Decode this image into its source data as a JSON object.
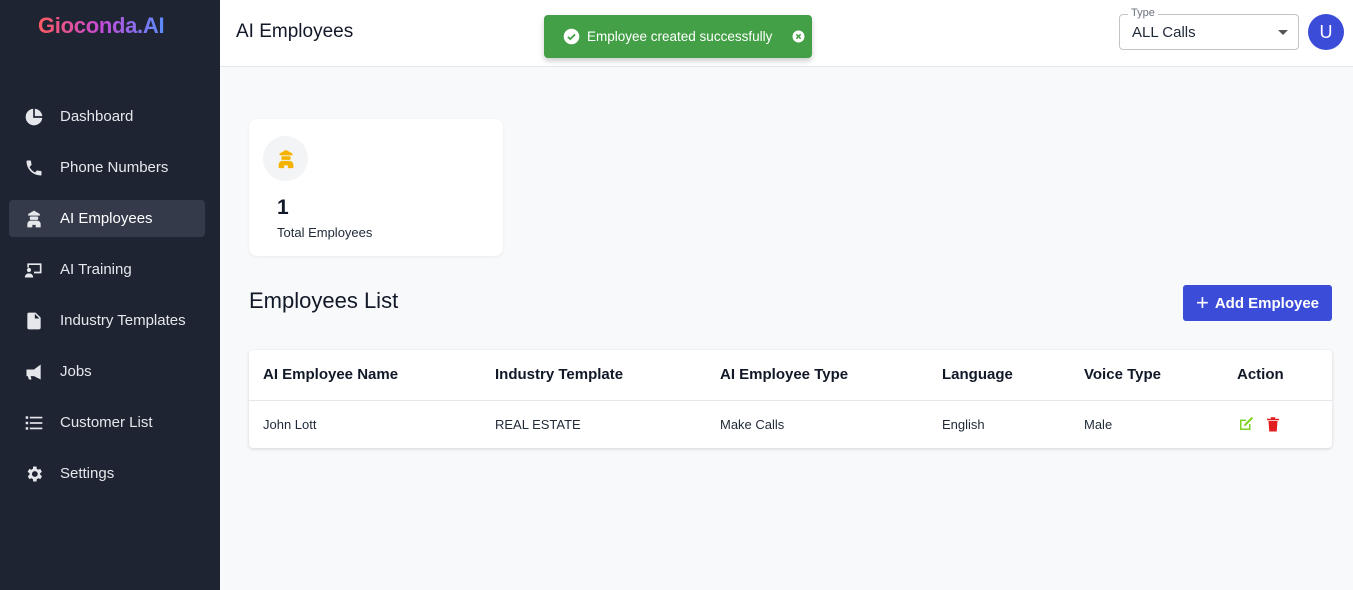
{
  "app": {
    "logo": "Gioconda.AI"
  },
  "sidebar": {
    "items": [
      {
        "label": "Dashboard",
        "icon": "pie-chart-icon"
      },
      {
        "label": "Phone Numbers",
        "icon": "phone-icon"
      },
      {
        "label": "AI Employees",
        "icon": "employee-icon",
        "active": true
      },
      {
        "label": "AI Training",
        "icon": "training-icon"
      },
      {
        "label": "Industry Templates",
        "icon": "document-icon"
      },
      {
        "label": "Jobs",
        "icon": "megaphone-icon"
      },
      {
        "label": "Customer List",
        "icon": "list-icon"
      },
      {
        "label": "Settings",
        "icon": "gear-icon"
      }
    ]
  },
  "header": {
    "title": "AI Employees",
    "type_select": {
      "label": "Type",
      "value": "ALL Calls"
    },
    "avatar_initial": "U"
  },
  "toast": {
    "message": "Employee created successfully",
    "color": "#43a047"
  },
  "stats": {
    "value": "1",
    "label": "Total Employees"
  },
  "employees": {
    "title": "Employees List",
    "add_label": "Add Employee",
    "columns": [
      "AI Employee Name",
      "Industry Template",
      "AI Employee Type",
      "Language",
      "Voice Type",
      "Action"
    ],
    "rows": [
      {
        "name": "John Lott",
        "template": "REAL ESTATE",
        "type": "Make Calls",
        "language": "English",
        "voice": "Male"
      }
    ]
  },
  "colors": {
    "sidebar_bg": "#1f2433",
    "accent": "#3b4cd8",
    "edit": "#7ed321",
    "delete": "#e11d1d"
  }
}
